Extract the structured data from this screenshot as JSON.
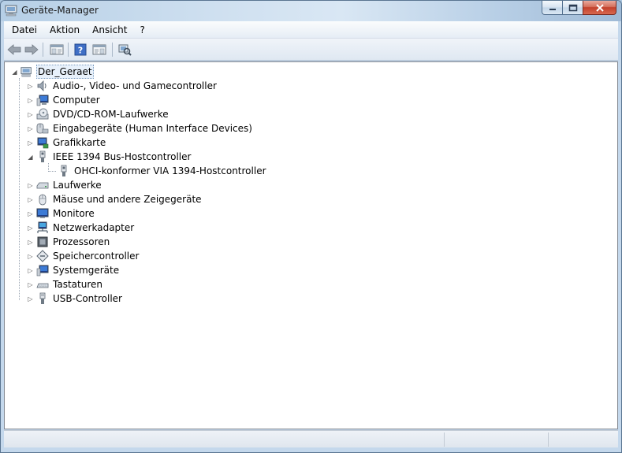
{
  "window": {
    "title": "Geräte-Manager"
  },
  "menu": {
    "items": [
      "Datei",
      "Aktion",
      "Ansicht",
      "?"
    ]
  },
  "toolbar": {
    "buttons": [
      "back-arrow-icon",
      "forward-arrow-icon",
      "console-tree-icon",
      "help-icon",
      "properties-icon",
      "scan-hardware-icon"
    ]
  },
  "tree": {
    "root": {
      "label": "Der_Geraet",
      "icon": "computer-icon",
      "expanded": true
    },
    "items": [
      {
        "label": "Audio-, Video- und Gamecontroller",
        "icon": "speaker-icon"
      },
      {
        "label": "Computer",
        "icon": "monitor-icon"
      },
      {
        "label": "DVD/CD-ROM-Laufwerke",
        "icon": "dvd-drive-icon"
      },
      {
        "label": "Eingabegeräte (Human Interface Devices)",
        "icon": "keyboard-mouse-icon"
      },
      {
        "label": "Grafikkarte",
        "icon": "display-adapter-icon"
      },
      {
        "label": "IEEE 1394 Bus-Hostcontroller",
        "icon": "firewire-icon",
        "expanded": true
      },
      {
        "label": "OHCI-konformer VIA 1394-Hostcontroller",
        "icon": "firewire-icon",
        "child": true
      },
      {
        "label": "Laufwerke",
        "icon": "disk-drive-icon"
      },
      {
        "label": "Mäuse und andere Zeigegeräte",
        "icon": "mouse-icon"
      },
      {
        "label": "Monitore",
        "icon": "monitor-icon"
      },
      {
        "label": "Netzwerkadapter",
        "icon": "network-adapter-icon"
      },
      {
        "label": "Prozessoren",
        "icon": "processor-icon"
      },
      {
        "label": "Speichercontroller",
        "icon": "storage-controller-icon"
      },
      {
        "label": "Systemgeräte",
        "icon": "system-device-icon"
      },
      {
        "label": "Tastaturen",
        "icon": "keyboard-icon"
      },
      {
        "label": "USB-Controller",
        "icon": "usb-icon"
      }
    ]
  },
  "colors": {
    "frame": "#b9d1e8",
    "close_button": "#c2402b",
    "selection_border": "#7c9cc0"
  }
}
